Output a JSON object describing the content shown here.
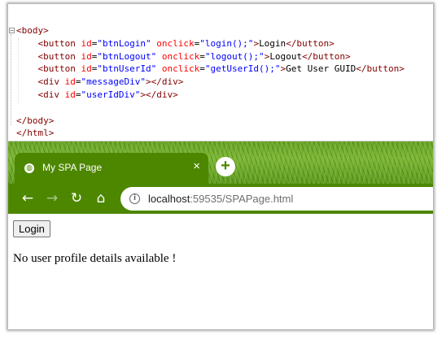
{
  "editor": {
    "lines": [
      {
        "parts": [
          {
            "c": "t",
            "s": "<body>"
          }
        ]
      },
      {
        "parts": [
          {
            "c": "p",
            "s": "    "
          },
          {
            "c": "t",
            "s": "<button"
          },
          {
            "c": "p",
            "s": " "
          },
          {
            "c": "a",
            "s": "id"
          },
          {
            "c": "p",
            "s": "="
          },
          {
            "c": "v",
            "s": "\"btnLogin\""
          },
          {
            "c": "p",
            "s": " "
          },
          {
            "c": "a",
            "s": "onclick"
          },
          {
            "c": "p",
            "s": "="
          },
          {
            "c": "v",
            "s": "\"login();\""
          },
          {
            "c": "t",
            "s": ">"
          },
          {
            "c": "p",
            "s": "Login"
          },
          {
            "c": "t",
            "s": "</button>"
          }
        ]
      },
      {
        "parts": [
          {
            "c": "p",
            "s": "    "
          },
          {
            "c": "t",
            "s": "<button"
          },
          {
            "c": "p",
            "s": " "
          },
          {
            "c": "a",
            "s": "id"
          },
          {
            "c": "p",
            "s": "="
          },
          {
            "c": "v",
            "s": "\"btnLogout\""
          },
          {
            "c": "p",
            "s": " "
          },
          {
            "c": "a",
            "s": "onclick"
          },
          {
            "c": "p",
            "s": "="
          },
          {
            "c": "v",
            "s": "\"logout();\""
          },
          {
            "c": "t",
            "s": ">"
          },
          {
            "c": "p",
            "s": "Logout"
          },
          {
            "c": "t",
            "s": "</button>"
          }
        ]
      },
      {
        "parts": [
          {
            "c": "p",
            "s": "    "
          },
          {
            "c": "t",
            "s": "<button"
          },
          {
            "c": "p",
            "s": " "
          },
          {
            "c": "a",
            "s": "id"
          },
          {
            "c": "p",
            "s": "="
          },
          {
            "c": "v",
            "s": "\"btnUserId\""
          },
          {
            "c": "p",
            "s": " "
          },
          {
            "c": "a",
            "s": "onclick"
          },
          {
            "c": "p",
            "s": "="
          },
          {
            "c": "v",
            "s": "\"getUserId();\""
          },
          {
            "c": "t",
            "s": ">"
          },
          {
            "c": "p",
            "s": "Get User GUID"
          },
          {
            "c": "t",
            "s": "</button>"
          }
        ]
      },
      {
        "parts": [
          {
            "c": "p",
            "s": "    "
          },
          {
            "c": "t",
            "s": "<div"
          },
          {
            "c": "p",
            "s": " "
          },
          {
            "c": "a",
            "s": "id"
          },
          {
            "c": "p",
            "s": "="
          },
          {
            "c": "v",
            "s": "\"messageDiv\""
          },
          {
            "c": "t",
            "s": "></div>"
          }
        ]
      },
      {
        "parts": [
          {
            "c": "p",
            "s": "    "
          },
          {
            "c": "t",
            "s": "<div"
          },
          {
            "c": "p",
            "s": " "
          },
          {
            "c": "a",
            "s": "id"
          },
          {
            "c": "p",
            "s": "="
          },
          {
            "c": "v",
            "s": "\"userIdDiv\""
          },
          {
            "c": "t",
            "s": "></div>"
          }
        ]
      },
      {
        "parts": [
          {
            "c": "p",
            "s": ""
          }
        ]
      },
      {
        "parts": [
          {
            "c": "t",
            "s": "</body>"
          }
        ]
      },
      {
        "parts": [
          {
            "c": "t",
            "s": "</html>"
          }
        ]
      }
    ]
  },
  "browser": {
    "tab_title": "My SPA Page",
    "tab_close": "×",
    "new_tab": "+",
    "back": "←",
    "forward": "→",
    "reload": "↻",
    "home": "⌂",
    "info": "i",
    "url_host": "localhost",
    "url_rest": ":59535/SPAPage.html",
    "theme_color": "#4d8700"
  },
  "page": {
    "login_button": "Login",
    "message": "No user profile details available !"
  }
}
